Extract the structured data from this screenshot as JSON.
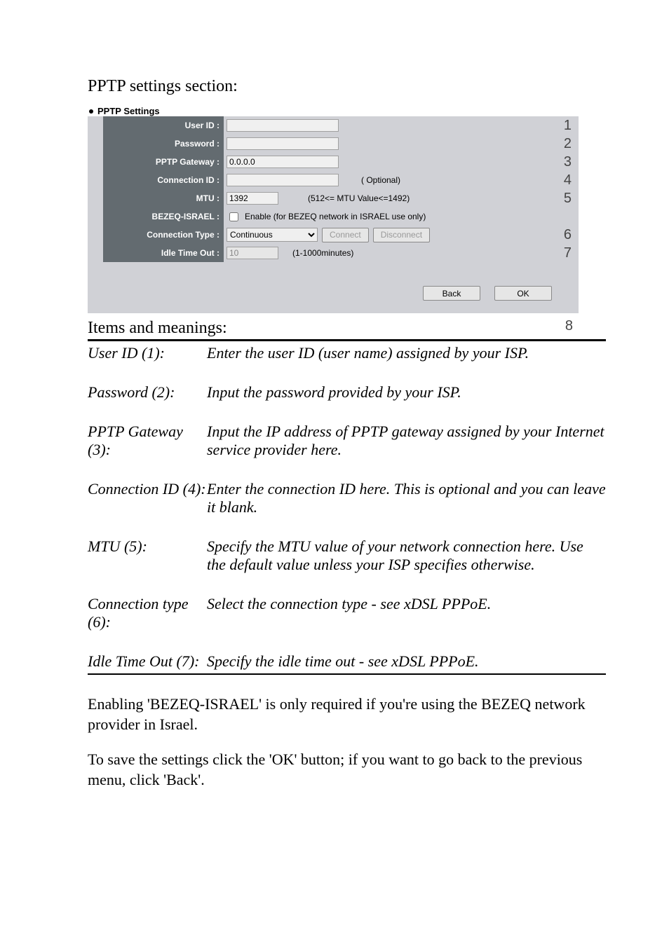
{
  "title": "PPTP settings section:",
  "screenshot": {
    "heading": "PPTP Settings",
    "rows": {
      "user_id": {
        "label": "User ID :",
        "marker": "1"
      },
      "password": {
        "label": "Password :",
        "marker": "2"
      },
      "gateway": {
        "label": "PPTP Gateway :",
        "value": "0.0.0.0",
        "marker": "3"
      },
      "conn_id": {
        "label": "Connection ID :",
        "hint": "( Optional)",
        "marker": "4"
      },
      "mtu": {
        "label": "MTU :",
        "value": "1392",
        "hint": "(512<= MTU Value<=1492)",
        "marker": "5"
      },
      "bezeq": {
        "label": "BEZEQ-ISRAEL :",
        "hint": "Enable (for BEZEQ network in ISRAEL use only)"
      },
      "conn_type": {
        "label": "Connection Type :",
        "selected": "Continuous",
        "connect": "Connect",
        "disconnect": "Disconnect",
        "marker": "6"
      },
      "idle": {
        "label": "Idle Time Out :",
        "value": "10",
        "hint": "(1-1000minutes)",
        "marker": "7"
      }
    },
    "buttons": {
      "back": "Back",
      "ok": "OK"
    },
    "marker8": "8"
  },
  "items_heading": "Items and meanings:",
  "items": [
    {
      "term": "User ID (1):",
      "desc": "Enter the user ID (user name) assigned by your ISP."
    },
    {
      "term": "Password (2):",
      "desc": "Input the password provided by your ISP."
    },
    {
      "term": "PPTP Gateway (3):",
      "desc": "Input the IP address of PPTP gateway assigned by your Internet service provider here."
    },
    {
      "term": "Connection ID (4):",
      "desc": "Enter the connection ID here. This is optional and you can leave it blank."
    },
    {
      "term": "MTU (5):",
      "desc": "Specify the MTU value of your network connection here. Use the default value unless your ISP specifies otherwise."
    },
    {
      "term": "Connection type (6):",
      "desc": "Select the connection type - see xDSL PPPoE."
    },
    {
      "term": "Idle Time Out (7):",
      "desc": "Specify the idle time out - see xDSL PPPoE."
    }
  ],
  "tail1": "Enabling 'BEZEQ-ISRAEL' is only required if you're using the BEZEQ network provider in Israel.",
  "tail2": "To save the settings click the 'OK' button; if you want to go back to the previous menu, click 'Back'."
}
